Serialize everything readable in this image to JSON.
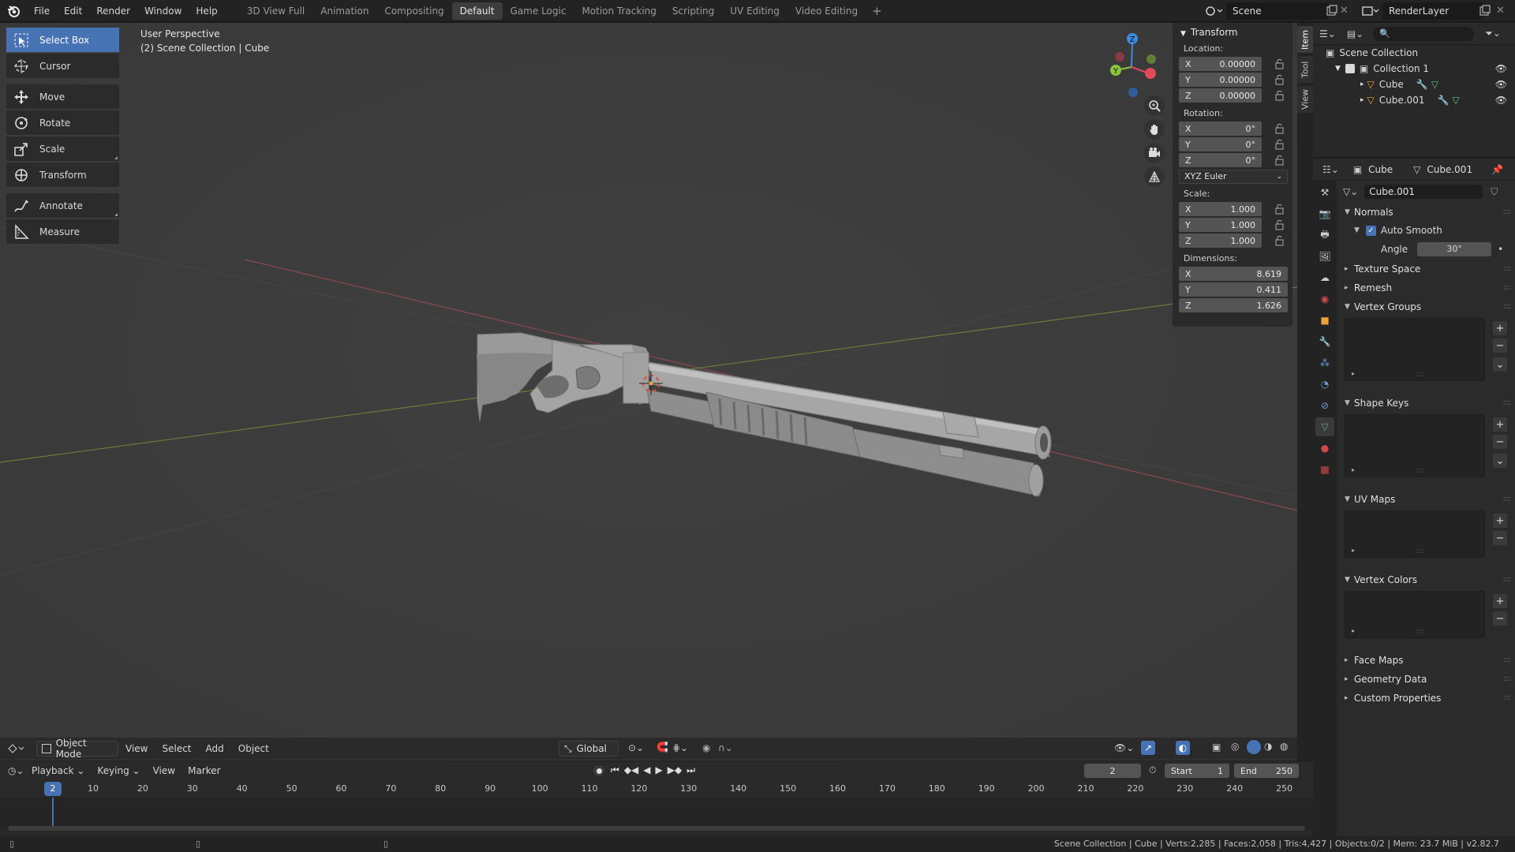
{
  "topbar": {
    "menus": [
      "File",
      "Edit",
      "Render",
      "Window",
      "Help"
    ],
    "workspaces": [
      "3D View Full",
      "Animation",
      "Compositing",
      "Default",
      "Game Logic",
      "Motion Tracking",
      "Scripting",
      "UV Editing",
      "Video Editing"
    ],
    "active_workspace": "Default",
    "scene_name": "Scene",
    "render_layer": "RenderLayer"
  },
  "viewport": {
    "perspective_label": "User Perspective",
    "collection_label": "(2) Scene Collection | Cube",
    "tools": [
      {
        "label": "Select Box",
        "icon": "select-box-icon",
        "active": true
      },
      {
        "label": "Cursor",
        "icon": "cursor-icon",
        "active": false
      },
      {
        "label": "Move",
        "icon": "move-icon",
        "active": false
      },
      {
        "label": "Rotate",
        "icon": "rotate-icon",
        "active": false
      },
      {
        "label": "Scale",
        "icon": "scale-icon",
        "active": false
      },
      {
        "label": "Transform",
        "icon": "transform-icon",
        "active": false
      },
      {
        "label": "Annotate",
        "icon": "annotate-icon",
        "active": false
      },
      {
        "label": "Measure",
        "icon": "measure-icon",
        "active": false
      }
    ],
    "gizmo_axes": {
      "x": "X",
      "y": "Y",
      "z": "Z"
    }
  },
  "npanel": {
    "title": "Transform",
    "location_label": "Location:",
    "location": {
      "x": "0.00000",
      "y": "0.00000",
      "z": "0.00000"
    },
    "rotation_label": "Rotation:",
    "rotation": {
      "x": "0°",
      "y": "0°",
      "z": "0°"
    },
    "rotation_mode": "XYZ Euler",
    "scale_label": "Scale:",
    "scale": {
      "x": "1.000",
      "y": "1.000",
      "z": "1.000"
    },
    "dimensions_label": "Dimensions:",
    "dimensions": {
      "x": "8.619",
      "y": "0.411",
      "z": "1.626"
    },
    "axis": {
      "x": "X",
      "y": "Y",
      "z": "Z"
    },
    "tabs": [
      "Item",
      "Tool",
      "View"
    ]
  },
  "vp_header": {
    "mode": "Object Mode",
    "menus": [
      "View",
      "Select",
      "Add",
      "Object"
    ],
    "orientation": "Global"
  },
  "timeline": {
    "menus": [
      "Playback",
      "Keying",
      "View",
      "Marker"
    ],
    "current_frame": "2",
    "start_label": "Start",
    "start": "1",
    "end_label": "End",
    "end": "250",
    "ruler": [
      "10",
      "20",
      "30",
      "40",
      "50",
      "60",
      "70",
      "80",
      "90",
      "100",
      "110",
      "120",
      "130",
      "140",
      "150",
      "160",
      "170",
      "180",
      "190",
      "200",
      "210",
      "220",
      "230",
      "240",
      "250"
    ],
    "playhead": "2"
  },
  "status": {
    "text": "Scene Collection | Cube | Verts:2,285 | Faces:2,058 | Tris:4,427 | Objects:0/2 | Mem: 23.7 MiB | v2.82.7"
  },
  "outliner": {
    "root": "Scene Collection",
    "collection": "Collection 1",
    "objects": [
      "Cube",
      "Cube.001"
    ]
  },
  "properties": {
    "object_name": "Cube",
    "mesh_name": "Cube.001",
    "datablock": "Cube.001",
    "normals": "Normals",
    "auto_smooth": "Auto Smooth",
    "angle_label": "Angle",
    "angle": "30°",
    "panels": [
      "Texture Space",
      "Remesh",
      "Vertex Groups",
      "Shape Keys",
      "UV Maps",
      "Vertex Colors",
      "Face Maps",
      "Geometry Data",
      "Custom Properties"
    ]
  },
  "colors": {
    "accent": "#4772b3",
    "viewport_bg": "#3c3c3c",
    "panel_bg": "#2a2a2a",
    "x_axis": "#e04a5a",
    "y_axis": "#8ac33c",
    "z_axis": "#3d8ae0"
  }
}
